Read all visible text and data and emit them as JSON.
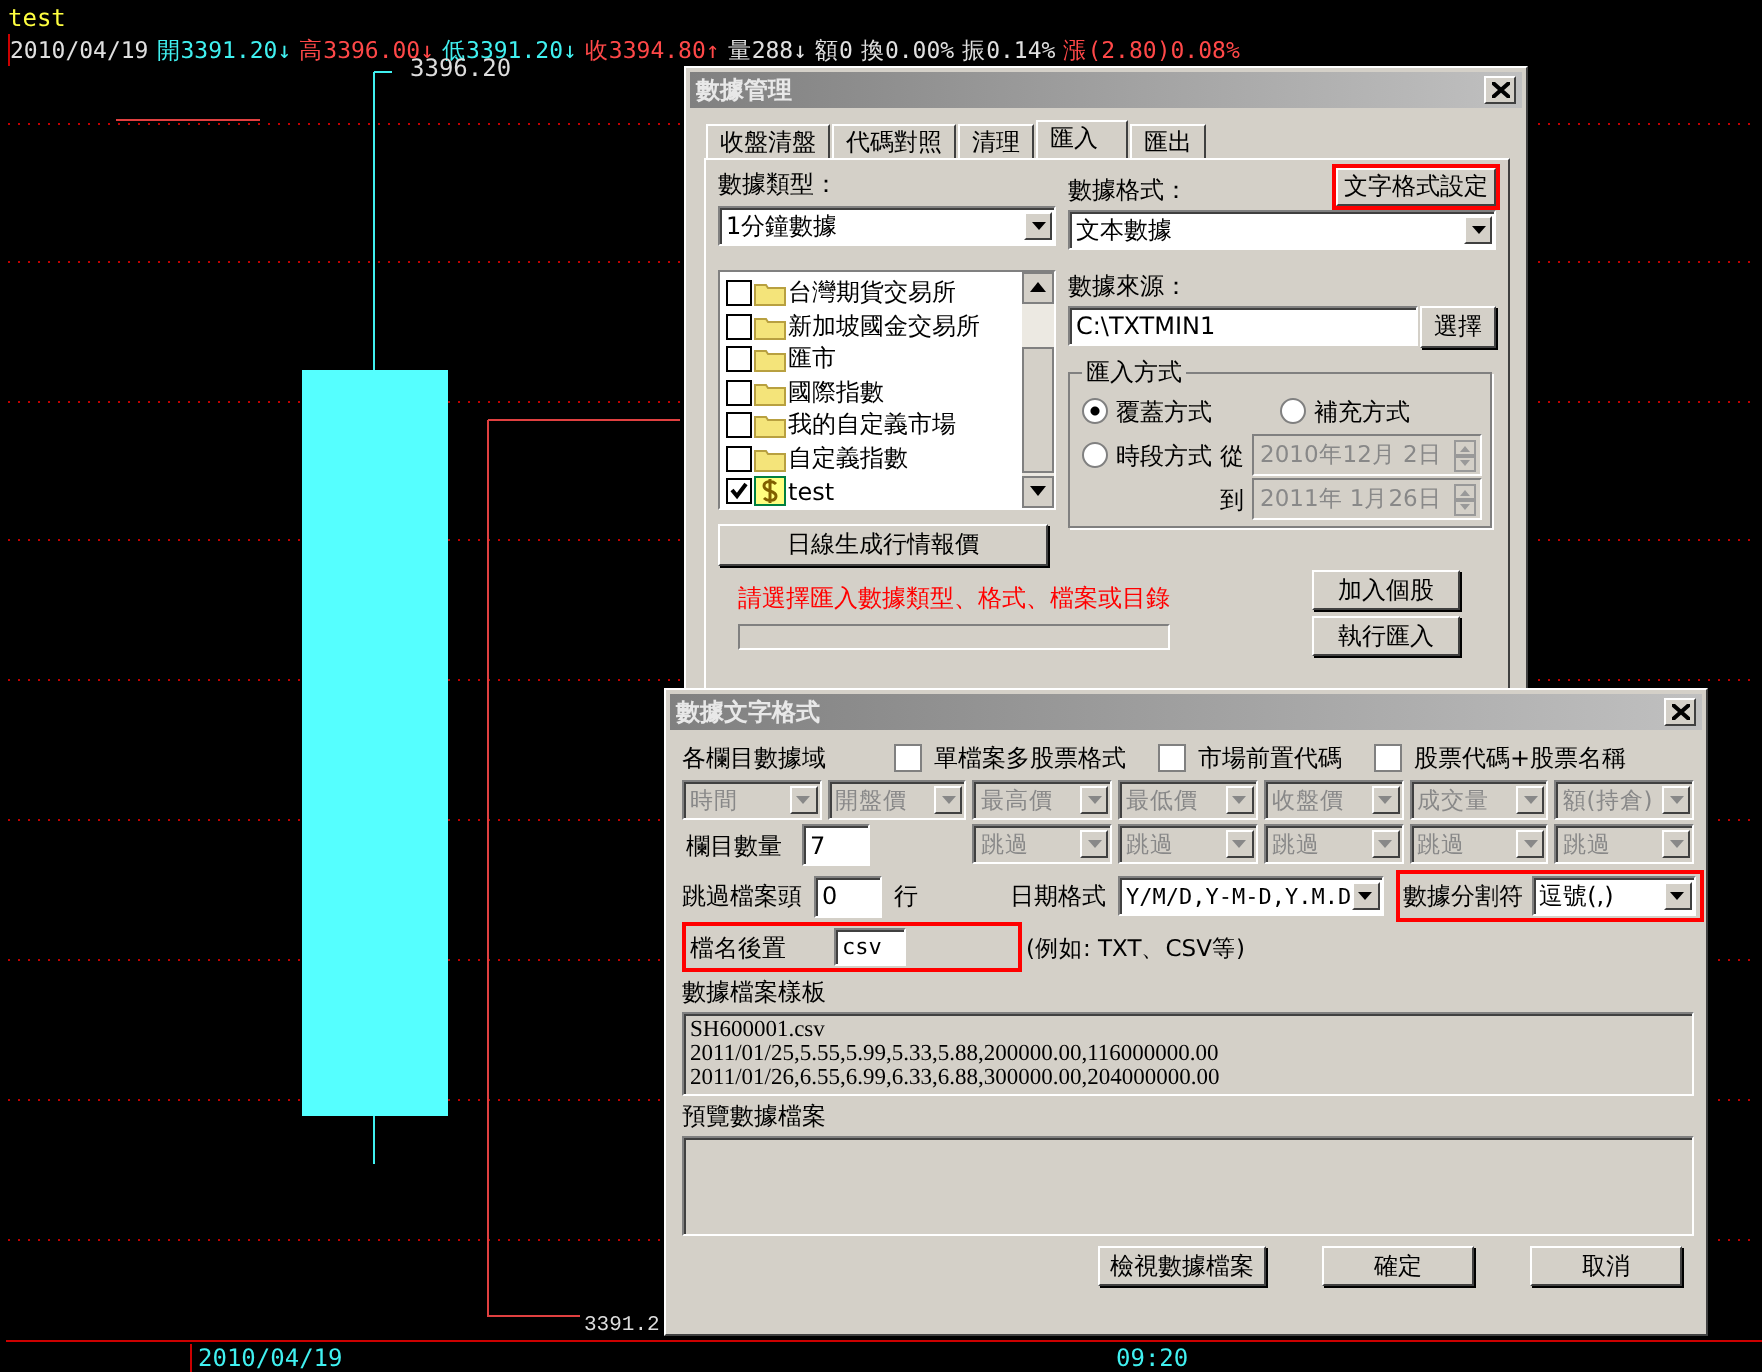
{
  "chart": {
    "title": "test",
    "quote": [
      {
        "text": "2010/04/19",
        "color": "#e0e0e0"
      },
      {
        "text": "開3391.20↓",
        "color": "#40f0f0"
      },
      {
        "text": "高3396.00↓",
        "color": "#ff4848"
      },
      {
        "text": "低3391.20↓",
        "color": "#40f0f0"
      },
      {
        "text": "收3394.80↑",
        "color": "#ff4848"
      },
      {
        "text": "量288↓",
        "color": "#e0e0e0"
      },
      {
        "text": "額0",
        "color": "#e0e0e0"
      },
      {
        "text": "換0.00%",
        "color": "#e0e0e0"
      },
      {
        "text": "振0.14%",
        "color": "#e0e0e0"
      },
      {
        "text": "漲(2.80)0.08%",
        "color": "#ff4848"
      }
    ],
    "high_label": "3396.20",
    "low_label": "3391.2",
    "x_labels": [
      "2010/04/19",
      "09:20"
    ]
  },
  "import_dialog": {
    "title": "數據管理",
    "tabs": [
      {
        "label": "收盤清盤",
        "selected": false
      },
      {
        "label": "代碼對照",
        "selected": false
      },
      {
        "label": "清理",
        "selected": false
      },
      {
        "label": "匯入",
        "selected": true
      },
      {
        "label": "匯出",
        "selected": false
      }
    ],
    "format_button": {
      "label": "文字格式設定",
      "highlighted": true
    },
    "type_label": "數據類型：",
    "type_value": "1分鐘數據",
    "format_label": "數據格式：",
    "format_value": "文本數據",
    "markets": [
      {
        "name": "台灣期貨交易所",
        "checked": false,
        "kind": "folder"
      },
      {
        "name": "新加坡國金交易所",
        "checked": false,
        "kind": "folder"
      },
      {
        "name": "匯市",
        "checked": false,
        "kind": "folder"
      },
      {
        "name": "國際指數",
        "checked": false,
        "kind": "folder"
      },
      {
        "name": "我的自定義市場",
        "checked": false,
        "kind": "folder"
      },
      {
        "name": "自定義指數",
        "checked": false,
        "kind": "folder"
      },
      {
        "name": "test",
        "checked": true,
        "kind": "stock"
      }
    ],
    "daily_button": "日線生成行情報價",
    "source_label": "數據來源：",
    "source_value": "C:\\TXTMIN1",
    "browse_button": "選擇",
    "mode_group": {
      "title": "匯入方式",
      "options": [
        {
          "label": "覆蓋方式",
          "selected": true
        },
        {
          "label": "補充方式",
          "selected": false
        },
        {
          "label": "時段方式",
          "selected": false
        }
      ],
      "from_label": "從",
      "from_date": "2010年12月 2日",
      "to_label": "到",
      "to_date": "2011年 1月26日",
      "dates_disabled": true
    },
    "message": "請選擇匯入數據類型、格式、檔案或目錄",
    "progress": {
      "level": 0
    },
    "add_button": "加入個股",
    "run_button": "執行匯入"
  },
  "format_dialog": {
    "title": "數據文字格式",
    "fields_label": "各欄目數據域",
    "options": [
      {
        "label": "單檔案多股票格式",
        "checked": false
      },
      {
        "label": "市場前置代碼",
        "checked": false
      },
      {
        "label": "股票代碼+股票名稱",
        "checked": false
      }
    ],
    "columns": [
      {
        "value": "時間",
        "disabled": true
      },
      {
        "value": "開盤價",
        "disabled": true
      },
      {
        "value": "最高價",
        "disabled": true
      },
      {
        "value": "最低價",
        "disabled": true
      },
      {
        "value": "收盤價",
        "disabled": true
      },
      {
        "value": "成交量",
        "disabled": true
      },
      {
        "value": "額(持倉)",
        "disabled": true
      }
    ],
    "count_label": "欄目數量",
    "count_value": "7",
    "skip_columns": [
      {
        "value": "跳過",
        "disabled": true
      },
      {
        "value": "跳過",
        "disabled": true
      },
      {
        "value": "跳過",
        "disabled": true
      },
      {
        "value": "跳過",
        "disabled": true
      },
      {
        "value": "跳過",
        "disabled": true
      }
    ],
    "skip_label": "跳過檔案頭",
    "skip_value": "0",
    "skip_unit": "行",
    "date_label": "日期格式",
    "date_value": "Y/M/D,Y-M-D,Y.M.D",
    "separator": {
      "label": "數據分割符",
      "value": "逗號(,)",
      "highlighted": true
    },
    "suffix": {
      "label": "檔名後置",
      "value": "csv",
      "highlighted": true
    },
    "suffix_hint": "(例如: TXT、CSV等)",
    "sample_label": "數據檔案樣板",
    "sample_lines": [
      "SH600001.csv",
      "2011/01/25,5.55,5.99,5.33,5.88,200000.00,116000000.00",
      "2011/01/26,6.55,6.99,6.33,6.88,300000.00,204000000.00"
    ],
    "preview_label": "預覽數據檔案",
    "buttons": [
      "檢視數據檔案",
      "確定",
      "取消"
    ]
  }
}
